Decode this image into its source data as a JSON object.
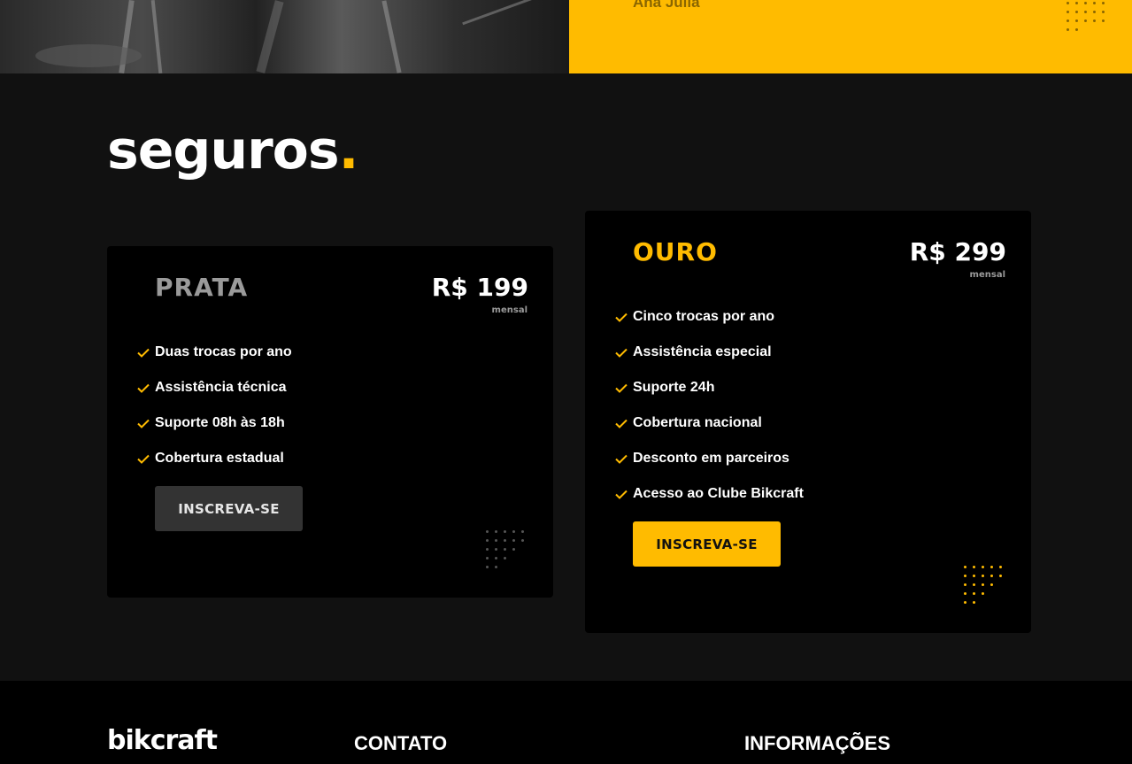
{
  "colors": {
    "accent": "#FFBB00",
    "background": "#111111",
    "card": "#000000",
    "prata_button": "#333333",
    "prata_name": "#9A9A9A"
  },
  "testimonial": {
    "author": "Ana Júlia"
  },
  "section": {
    "title": "seguros",
    "title_dot": "."
  },
  "plans": [
    {
      "name": "PRATA",
      "price": "R$ 199",
      "period": "mensal",
      "features": [
        "Duas trocas por ano",
        "Assistência técnica",
        "Suporte 08h às 18h",
        "Cobertura estadual"
      ],
      "cta": "INSCREVA-SE"
    },
    {
      "name": "OURO",
      "price": "R$ 299",
      "period": "mensal",
      "features": [
        "Cinco trocas por ano",
        "Assistência especial",
        "Suporte 24h",
        "Cobertura nacional",
        "Desconto em parceiros",
        "Acesso ao Clube Bikcraft"
      ],
      "cta": "INSCREVA-SE"
    }
  ],
  "footer": {
    "logo": "bikcraft",
    "contact_heading": "CONTATO",
    "info_heading": "INFORMAÇÕES"
  },
  "icons": {
    "feature_check": "check-icon",
    "decoration": "dots-pattern-icon"
  }
}
